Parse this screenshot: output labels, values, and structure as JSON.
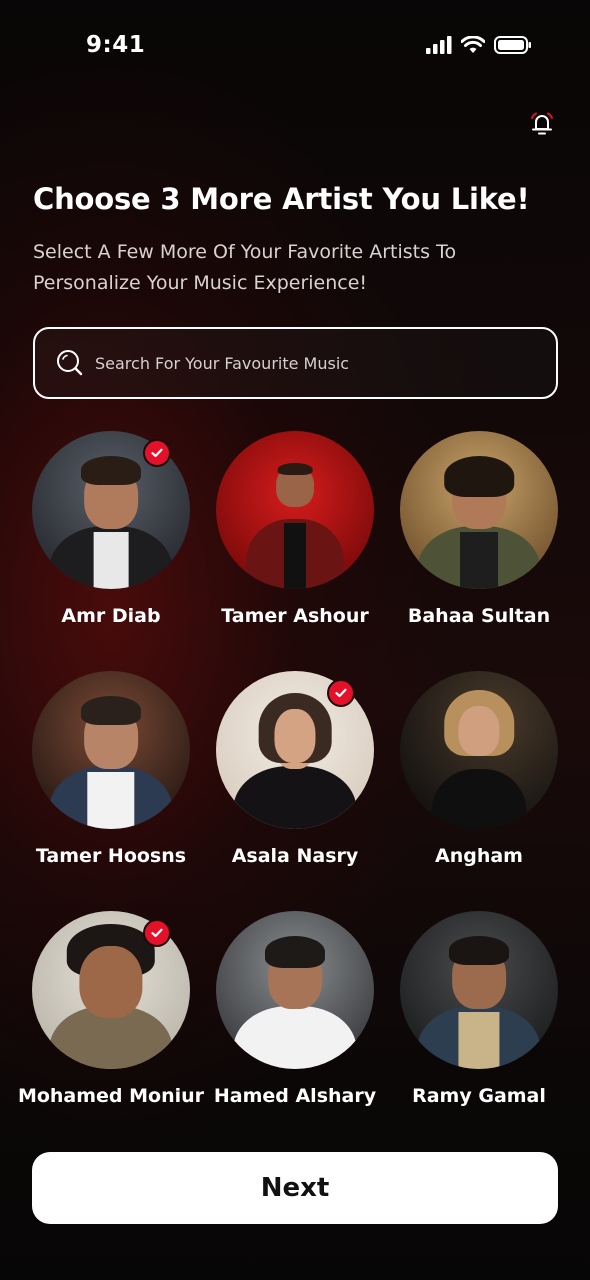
{
  "status_bar": {
    "time": "9:41"
  },
  "header": {
    "title": "Choose 3 More Artist You Like!",
    "subtitle": "Select A Few More Of Your Favorite Artists To Personalize Your Music Experience!"
  },
  "search": {
    "placeholder": "Search For Your Favourite Music"
  },
  "artists": [
    {
      "name": "Amr Diab",
      "selected": true
    },
    {
      "name": "Tamer Ashour",
      "selected": false
    },
    {
      "name": "Bahaa Sultan",
      "selected": false
    },
    {
      "name": "Tamer Hoosns",
      "selected": false
    },
    {
      "name": "Asala Nasry",
      "selected": true
    },
    {
      "name": "Angham",
      "selected": false
    },
    {
      "name": "Mohamed Moniur",
      "selected": true
    },
    {
      "name": "Hamed Alshary",
      "selected": false
    },
    {
      "name": "Ramy Gamal",
      "selected": false
    }
  ],
  "next_button": {
    "label": "Next"
  },
  "colors": {
    "accent": "#e3112a",
    "background": "#0a0708",
    "button": "#ffffff"
  }
}
